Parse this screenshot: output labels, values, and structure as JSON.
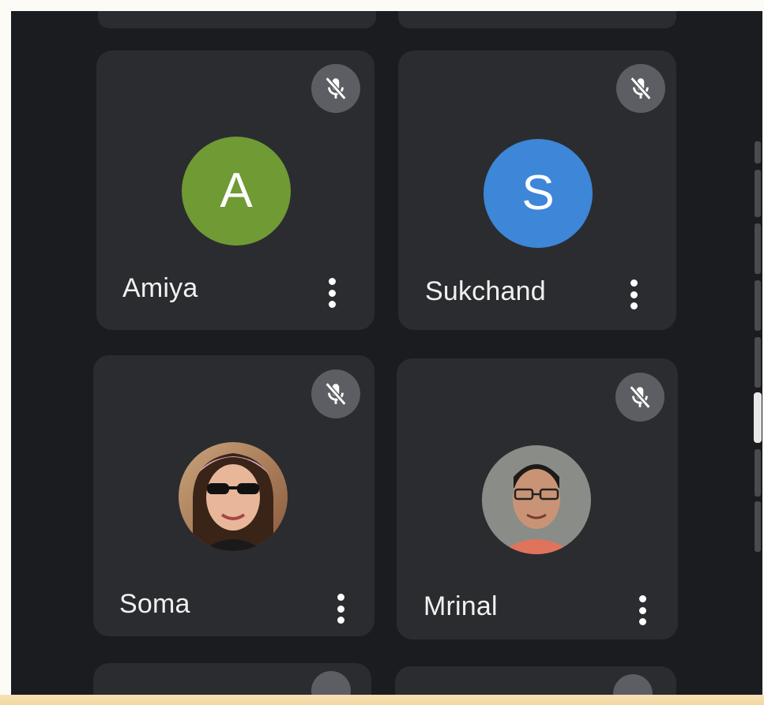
{
  "participants": [
    {
      "name": "Amiya",
      "avatar_type": "letter",
      "initial": "A",
      "avatar_color": "#6f9a34",
      "mic": "muted",
      "mute_icon": "mic-off-icon",
      "menu_icon": "more-vert-icon"
    },
    {
      "name": "Sukchand",
      "avatar_type": "letter",
      "initial": "S",
      "avatar_color": "#3d86d8",
      "mic": "muted",
      "mute_icon": "mic-off-icon",
      "menu_icon": "more-vert-icon"
    },
    {
      "name": "Soma",
      "avatar_type": "photo",
      "mic": "muted",
      "mute_icon": "mic-off-icon",
      "menu_icon": "more-vert-icon"
    },
    {
      "name": "Mrinal",
      "avatar_type": "photo",
      "mic": "muted",
      "mute_icon": "mic-off-icon",
      "menu_icon": "more-vert-icon"
    }
  ],
  "colors": {
    "background": "#1b1c1f",
    "tile": "#2b2c30",
    "mute_button": "#5c5e63",
    "text": "#f1f1f1"
  }
}
